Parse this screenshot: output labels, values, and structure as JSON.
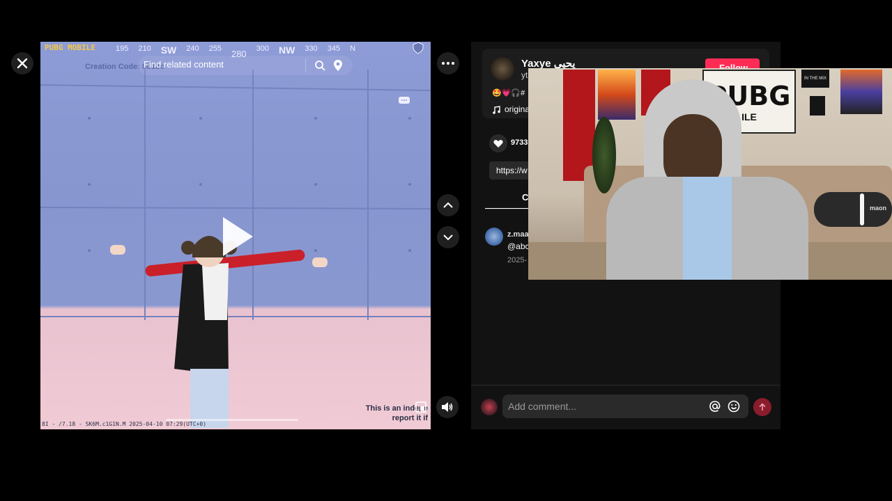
{
  "player": {
    "search_placeholder": "Find related content",
    "hud_logo": "PUBG MOBILE",
    "hud_creation_code": "Creation Code: 8b1bc",
    "compass_marks": [
      "195",
      "210",
      "SW",
      "240",
      "255",
      "280",
      "300",
      "NW",
      "330",
      "345",
      "N"
    ],
    "footer_watermark": "8I - /7.18 - SK6M.c1G1N.M   2025-04-10 07:29(UTC+0)",
    "notice_line1": "This is an indepe",
    "notice_line2": "report it if"
  },
  "controls": {
    "close_icon": "close-icon",
    "more_icon": "more-icon",
    "up_icon": "chevron-up-icon",
    "down_icon": "chevron-down-icon",
    "volume_icon": "volume-icon"
  },
  "post": {
    "author_name": "Yaxye يحيى",
    "author_handle": "yt",
    "follow_label": "Follow",
    "emojis": "🤩💗🎧#",
    "sound_label": "origina",
    "like_count": "9733",
    "link_text": "https://w",
    "tab_label": "C"
  },
  "comment": {
    "user": "z.maa",
    "text": "@abc",
    "date": "2025-"
  },
  "composer": {
    "placeholder": "Add comment...",
    "mention_icon": "at-icon",
    "emoji_icon": "emoji-icon",
    "send_icon": "send-icon"
  },
  "webcam": {
    "poster_text": "PUBG",
    "poster_sub": "ILE",
    "small_poster": "IN THE MIX",
    "mic_brand": "maon"
  },
  "colors": {
    "follow_red": "#fe2c55",
    "panel_bg": "#121212",
    "send_red": "#8a1c2c"
  }
}
